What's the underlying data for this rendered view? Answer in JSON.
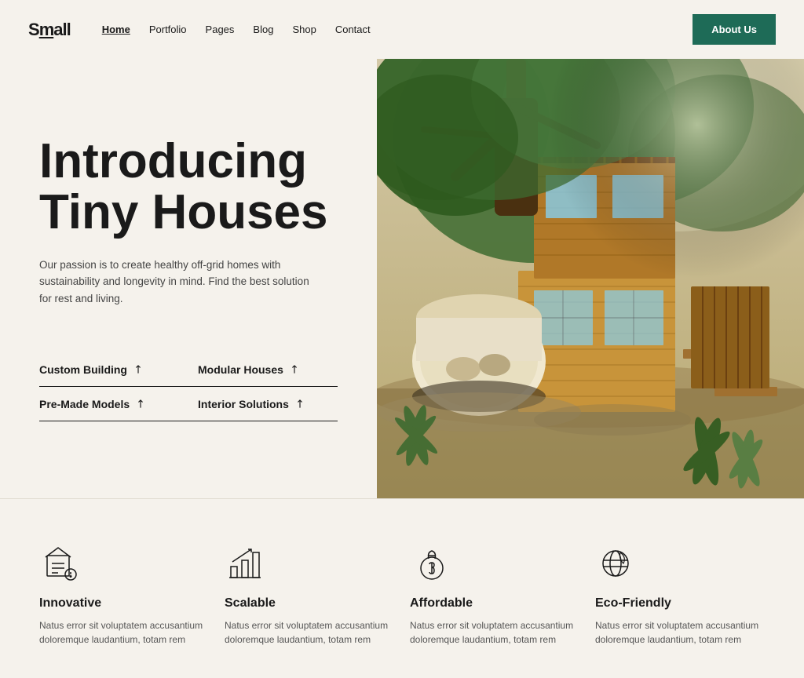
{
  "site": {
    "logo": "Small",
    "logo_underline": "mall"
  },
  "nav": {
    "links": [
      {
        "label": "Home",
        "active": true
      },
      {
        "label": "Portfolio",
        "active": false
      },
      {
        "label": "Pages",
        "active": false
      },
      {
        "label": "Blog",
        "active": false
      },
      {
        "label": "Shop",
        "active": false
      },
      {
        "label": "Contact",
        "active": false
      }
    ],
    "cta": "About Us"
  },
  "hero": {
    "title_line1": "Introducing",
    "title_line2": "Tiny Houses",
    "subtitle": "Our passion is to create healthy off-grid homes with sustainability and longevity in mind. Find the best solution for rest and living.",
    "links": [
      {
        "label": "Custom Building",
        "id": "custom-building"
      },
      {
        "label": "Modular Houses",
        "id": "modular-houses"
      },
      {
        "label": "Pre-Made Models",
        "id": "pre-made-models"
      },
      {
        "label": "Interior Solutions",
        "id": "interior-solutions"
      }
    ]
  },
  "features": [
    {
      "id": "innovative",
      "icon": "innovative-icon",
      "name": "Innovative",
      "description": "Natus error sit voluptatem accusantium doloremque laudantium, totam rem"
    },
    {
      "id": "scalable",
      "icon": "scalable-icon",
      "name": "Scalable",
      "description": "Natus error sit voluptatem accusantium doloremque laudantium, totam rem"
    },
    {
      "id": "affordable",
      "icon": "affordable-icon",
      "name": "Affordable",
      "description": "Natus error sit voluptatem accusantium doloremque laudantium, totam rem"
    },
    {
      "id": "eco-friendly",
      "icon": "eco-friendly-icon",
      "name": "Eco-Friendly",
      "description": "Natus error sit voluptatem accusantium doloremque laudantium, totam rem"
    }
  ],
  "colors": {
    "accent": "#1e6b57",
    "bg": "#f5f2ec",
    "text": "#1a1a1a"
  }
}
